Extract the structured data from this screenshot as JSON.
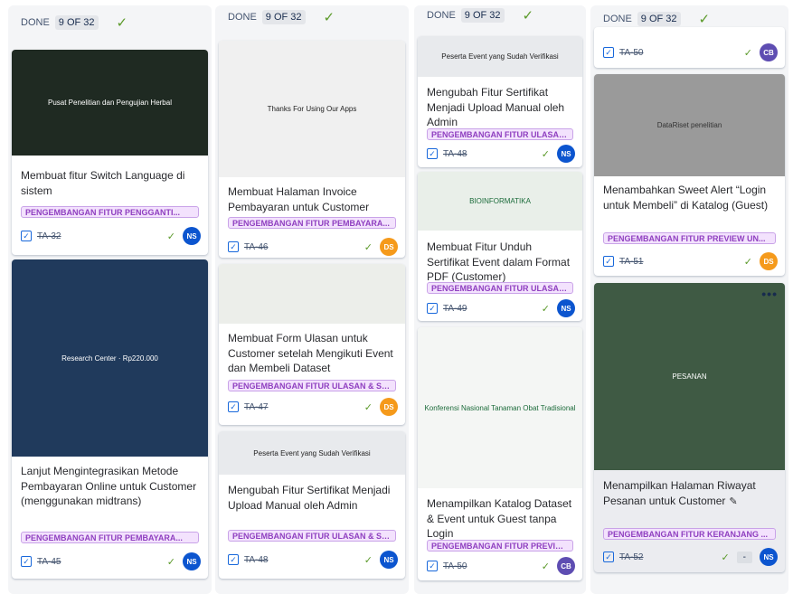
{
  "columns": [
    {
      "status": "DONE",
      "count": "9 OF 32",
      "cards": [
        {
          "title": "Membuat fitur Switch Language di sistem",
          "tag": "PENGEMBANGAN FITUR PENGGANTI...",
          "key": "TA-32",
          "assignee": "NS",
          "thumb": "Pusat Penelitian dan Pengujian Herbal"
        },
        {
          "title": "Lanjut Mengintegrasikan Metode Pembayaran Online untuk Customer (menggunakan midtrans)",
          "tag": "PENGEMBANGAN FITUR PEMBAYARA...",
          "key": "TA-45",
          "assignee": "NS",
          "thumb": "Research Center · Rp220.000"
        }
      ]
    },
    {
      "status": "DONE",
      "count": "9 OF 32",
      "cards": [
        {
          "title": "Membuat Halaman Invoice Pembayaran untuk Customer",
          "tag": "PENGEMBANGAN FITUR PEMBAYARA...",
          "key": "TA-46",
          "assignee": "DS",
          "thumb": "Thanks For Using Our Apps"
        },
        {
          "title": "Membuat Form Ulasan untuk Customer setelah Mengikuti Event dan Membeli Dataset",
          "tag": "PENGEMBANGAN FITUR ULASAN & SE...",
          "key": "TA-47",
          "assignee": "DS",
          "thumb": ""
        },
        {
          "title": "Mengubah Fitur Sertifikat Menjadi Upload Manual oleh Admin",
          "tag": "PENGEMBANGAN FITUR ULASAN & SE...",
          "key": "TA-48",
          "assignee": "NS",
          "thumb": "Peserta Event yang Sudah Verifikasi"
        }
      ]
    },
    {
      "status": "DONE",
      "count": "9 OF 32",
      "cards": [
        {
          "title": "Mengubah Fitur Sertifikat Menjadi Upload Manual oleh Admin",
          "tag": "PENGEMBANGAN FITUR ULASAN & SE...",
          "key": "TA-48",
          "assignee": "NS",
          "thumb": "Peserta Event yang Sudah Verifikasi"
        },
        {
          "title": "Membuat Fitur Unduh Sertifikat Event dalam Format PDF (Customer)",
          "tag": "PENGEMBANGAN FITUR ULASAN & SE...",
          "key": "TA-49",
          "assignee": "NS",
          "thumb": "BIOINFORMATIKA"
        },
        {
          "title": "Menampilkan Katalog Dataset & Event untuk Guest tanpa Login",
          "tag": "PENGEMBANGAN FITUR PREVIEW UN...",
          "key": "TA-50",
          "assignee": "CB",
          "thumb": "Konferensi Nasional Tanaman Obat Tradisional"
        }
      ]
    },
    {
      "status": "DONE",
      "count": "9 OF 32",
      "cards": [
        {
          "title": "",
          "tag": "",
          "key": "TA-50",
          "assignee": "CB",
          "thumb": ""
        },
        {
          "title": "Menambahkan Sweet Alert “Login untuk Membeli” di Katalog (Guest)",
          "tag": "PENGEMBANGAN FITUR PREVIEW UN...",
          "key": "TA-51",
          "assignee": "DS",
          "thumb": "DataRiset penelitian"
        },
        {
          "title": "Menampilkan Halaman Riwayat Pesanan untuk Customer",
          "tag": "PENGEMBANGAN FITUR KERANJANG ...",
          "key": "TA-52",
          "assignee": "NS",
          "thumb": "PESANAN",
          "estimate": "-",
          "more": "•••"
        }
      ]
    }
  ],
  "colors": {
    "NS": "#0c55cf",
    "DS": "#f59a1b",
    "CB": "#5e4db2",
    "done": "#5b9a2a",
    "tag_bg": "#f3e2fd",
    "tag_text": "#8f3fc0"
  }
}
